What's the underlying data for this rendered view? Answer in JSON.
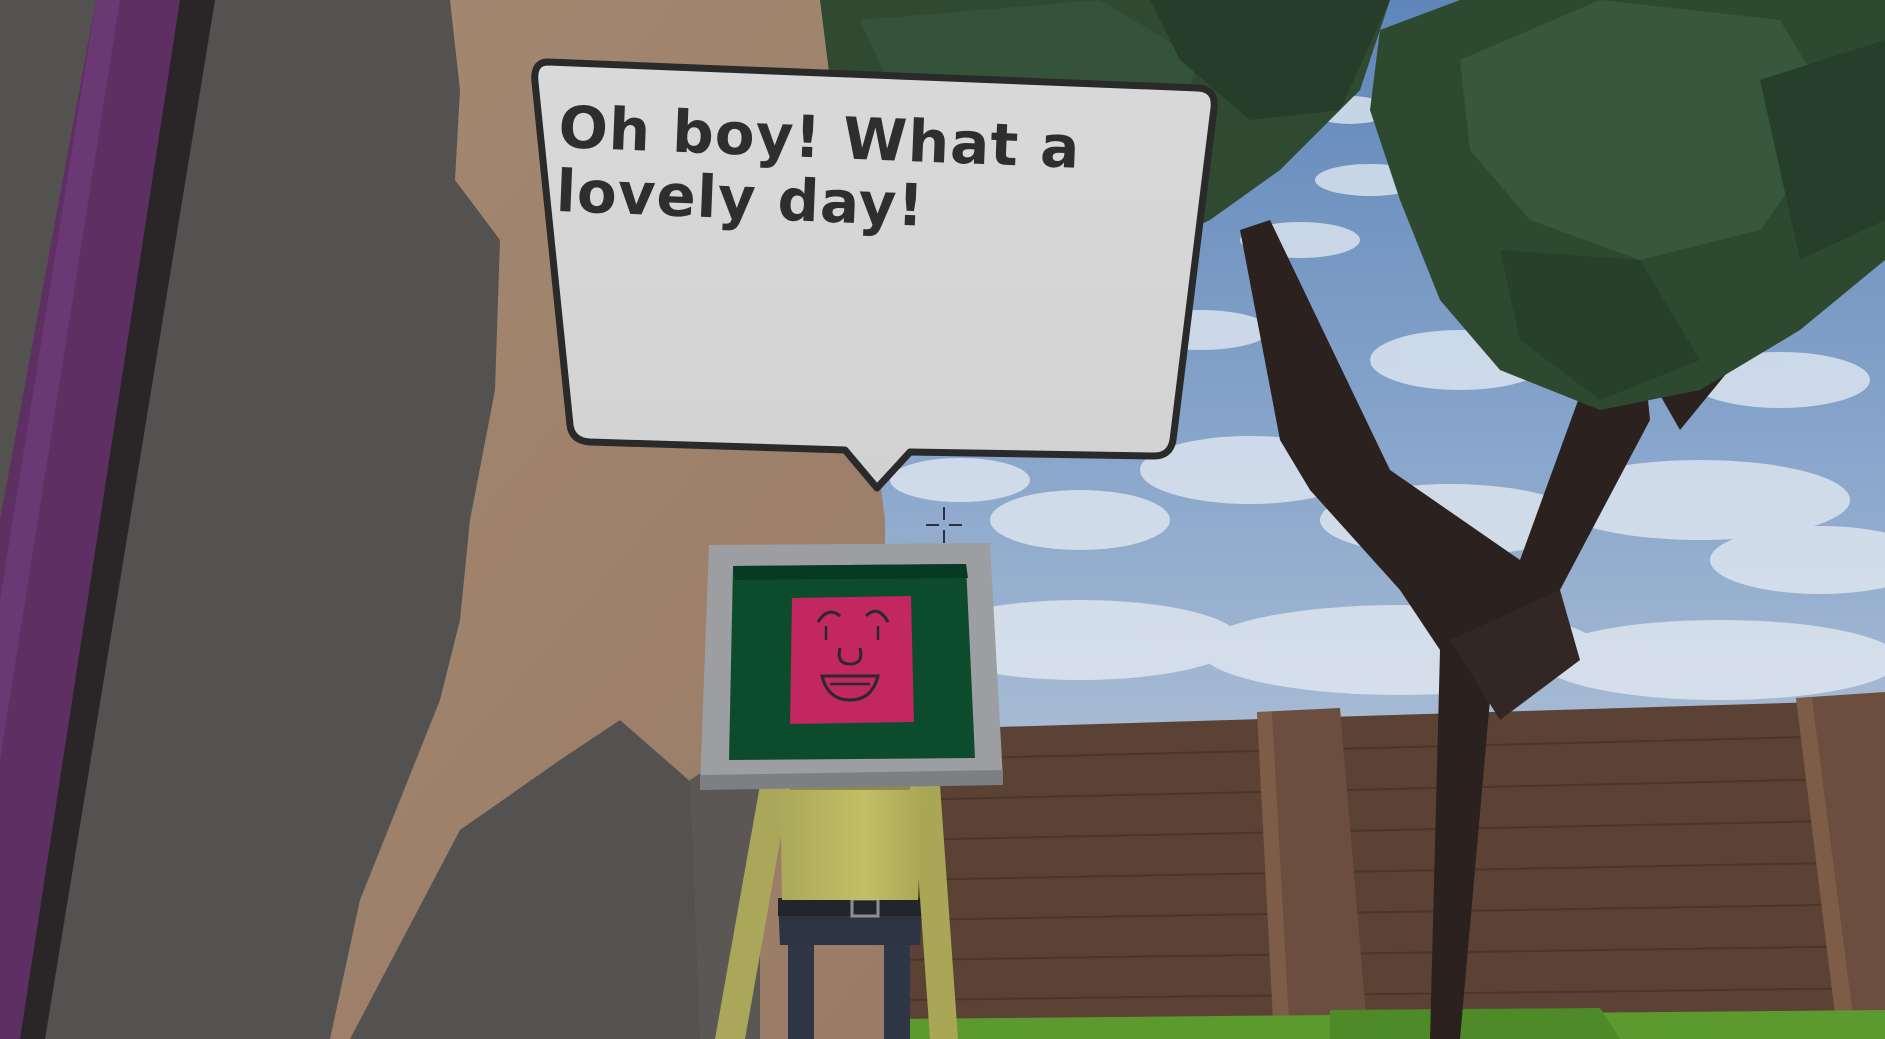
{
  "speech_bubble": {
    "text": "Oh boy! What a lovely day!"
  },
  "character": {
    "face_emotion": "happy"
  },
  "colors": {
    "sky": "#7d9cc7",
    "wall": "#a2866e",
    "wall_shadow": "#545250",
    "purple_pillar": "#5e2f63",
    "tree_leaves": "#2c442e",
    "trunk": "#2b2220",
    "fence": "#5a4133",
    "grass": "#5f9b30",
    "monitor_frame": "#9a9c9f",
    "screen_green": "#0b4b2c",
    "face_pink": "#c2275f",
    "shirt": "#b7b45c",
    "pants": "#2d3444",
    "bubble_fill": "#d7d7d7",
    "bubble_outline": "#2a2a2a"
  },
  "hud": {
    "crosshair_icon": "crosshair-icon"
  }
}
